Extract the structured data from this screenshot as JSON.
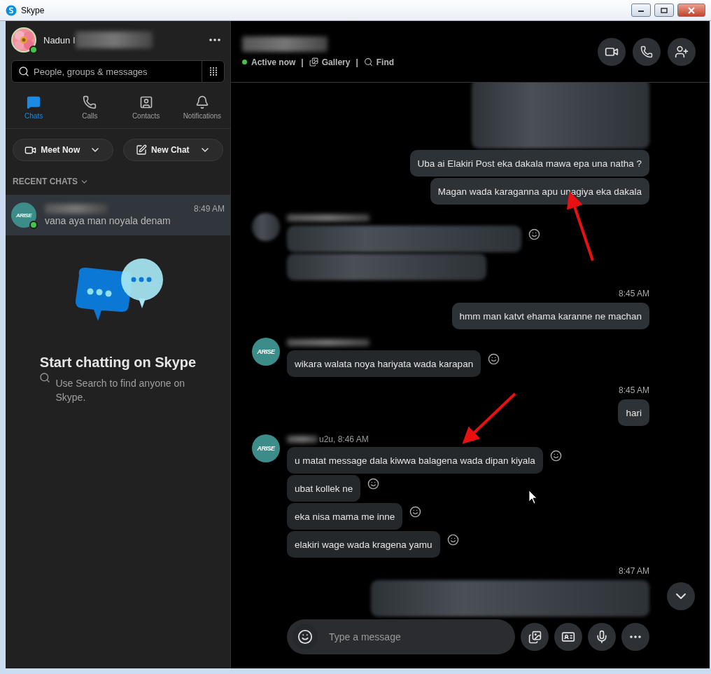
{
  "window": {
    "title": "Skype"
  },
  "profile": {
    "name": "Nadun I",
    "online": true
  },
  "search": {
    "placeholder": "People, groups & messages"
  },
  "nav_tabs": [
    {
      "kind": "chats",
      "label": "Chats",
      "selected": true
    },
    {
      "kind": "calls",
      "label": "Calls",
      "selected": false
    },
    {
      "kind": "contacts",
      "label": "Contacts",
      "selected": false
    },
    {
      "kind": "notifications",
      "label": "Notifications",
      "selected": false
    }
  ],
  "actions": [
    {
      "kind": "meet",
      "label": "Meet Now"
    },
    {
      "kind": "new_chat",
      "label": "New Chat"
    }
  ],
  "recent_chats": {
    "heading": "RECENT CHATS",
    "items": [
      {
        "avatar_text": "ARISE",
        "online": true,
        "time": "8:49 AM",
        "preview": "vana aya man noyala denam",
        "selected": true
      }
    ]
  },
  "empty_state": {
    "title": "Start chatting on Skype",
    "hint": "Use Search to find anyone on Skype."
  },
  "conversation": {
    "status": "Active now",
    "online": true,
    "separator": "|",
    "links": [
      {
        "kind": "gallery",
        "label": "Gallery"
      },
      {
        "kind": "find",
        "label": "Find"
      }
    ]
  },
  "messages": [
    {
      "kind": "outgoing",
      "messages": [
        {
          "kind": "blurred"
        },
        {
          "kind": "text",
          "text": "Uba ai Elakiri Post eka dakala mawa epa una natha ?"
        },
        {
          "kind": "text",
          "text": "Magan wada karaganna apu unagiya eka dakala"
        }
      ]
    },
    {
      "kind": "incoming",
      "messages": [
        {
          "kind": "blurred",
          "reaction": true
        },
        {
          "kind": "blurred",
          "reaction": false
        }
      ]
    },
    {
      "kind": "outgoing",
      "time": "8:45 AM",
      "messages": [
        {
          "kind": "text",
          "text": "hmm man katvt ehama karanne ne machan"
        }
      ]
    },
    {
      "kind": "incoming",
      "avatar_text": "ARISE",
      "messages": [
        {
          "kind": "text",
          "text": "wikara walata noya hariyata wada karapan",
          "reaction": true
        }
      ]
    },
    {
      "kind": "outgoing",
      "time": "8:45 AM",
      "messages": [
        {
          "kind": "text",
          "text": "hari"
        }
      ]
    },
    {
      "kind": "incoming",
      "avatar_text": "ARISE",
      "sender": "u2u, 8:46 AM",
      "messages": [
        {
          "kind": "text",
          "text": "u matat message dala kiwwa balagena wada dipan kiyala",
          "reaction": true
        },
        {
          "kind": "text",
          "text": "ubat kollek ne",
          "reaction": true
        },
        {
          "kind": "text",
          "text": "eka nisa mama me inne",
          "reaction": true
        },
        {
          "kind": "text",
          "text": "elakiri wage wada kragena yamu",
          "reaction": true
        }
      ]
    },
    {
      "kind": "outgoing",
      "time": "8:47 AM",
      "messages": [
        {
          "kind": "blurred"
        }
      ]
    }
  ],
  "composer": {
    "placeholder": "Type a message"
  }
}
